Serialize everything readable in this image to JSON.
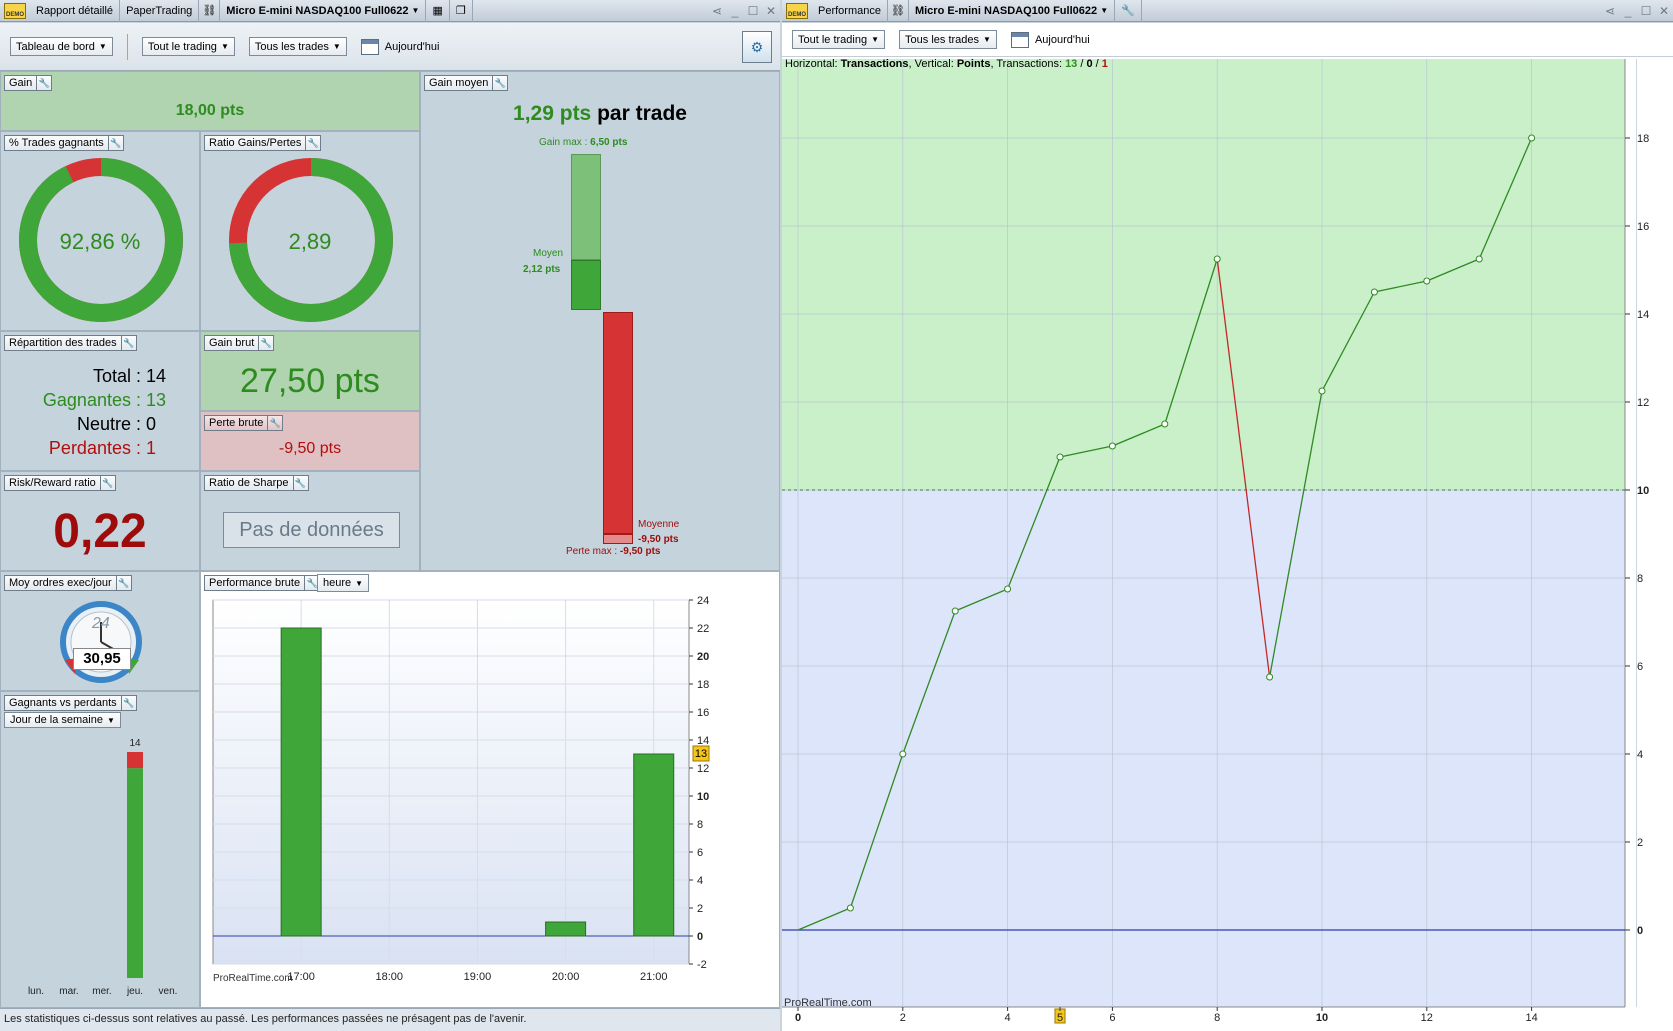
{
  "left_tabs": {
    "report": "Rapport détaillé",
    "paper": "PaperTrading",
    "instrument": "Micro E-mini NASDAQ100 Full0622"
  },
  "demo_label": "DEMO",
  "left_toolbar": {
    "dashboard": "Tableau de bord",
    "trading": "Tout le trading",
    "trades": "Tous les trades",
    "date": "Aujourd'hui"
  },
  "gain": {
    "title": "Gain",
    "value": "18,00 pts"
  },
  "win_pct": {
    "title": "% Trades gagnants",
    "value": "92,86 %",
    "fraction": 0.9286
  },
  "ratio": {
    "title": "Ratio Gains/Pertes",
    "value": "2,89",
    "win_fraction": 0.743
  },
  "avg_gain": {
    "title": "Gain moyen",
    "value": "1,29 pts",
    "suffix": "par trade",
    "max_label": "Gain max :",
    "max_value": "6,50 pts",
    "avg_label": "Moyen",
    "avg_value": "2,12 pts",
    "loss_avg_label": "Moyenne",
    "loss_avg_value": "-9,50 pts",
    "loss_max_label": "Perte max :",
    "loss_max_value": "-9,50 pts"
  },
  "repartition": {
    "title": "Répartition des trades",
    "total": "Total : 14",
    "winners": "Gagnantes : 13",
    "neutral": "Neutre : 0",
    "losers": "Perdantes : 1"
  },
  "gross_gain": {
    "title": "Gain brut",
    "value": "27,50 pts"
  },
  "gross_loss": {
    "title": "Perte brute",
    "value": "-9,50 pts"
  },
  "risk_reward": {
    "title": "Risk/Reward ratio",
    "value": "0,22"
  },
  "sharpe": {
    "title": "Ratio de Sharpe",
    "value": "Pas de données"
  },
  "orders_day": {
    "title": "Moy ordres exec/jour",
    "value": "30,95",
    "dial": "24"
  },
  "gross_perf": {
    "title": "Performance brute",
    "unit": "heure",
    "watermark": "ProRealTime.com",
    "last_marker": "13"
  },
  "win_loss": {
    "title": "Gagnants vs perdants",
    "period": "Jour de la semaine",
    "total_label": "14",
    "days": [
      "lun.",
      "mar.",
      "mer.",
      "jeu.",
      "ven."
    ]
  },
  "footer": "Les statistiques ci-dessus sont relatives au passé. Les performances passées ne présagent pas de l'avenir.",
  "right_tabs": {
    "perf": "Performance",
    "instrument": "Micro E-mini NASDAQ100 Full0622"
  },
  "right_toolbar": {
    "trading": "Tout le trading",
    "trades": "Tous les trades",
    "date": "Aujourd'hui"
  },
  "perf_header": {
    "h_label": "Horizontal:",
    "h_value": "Transactions",
    "v_label": "Vertical:",
    "v_value": "Points",
    "t_label": "Transactions:",
    "t_win": "13",
    "t_neutral": "0",
    "t_loss": "1"
  },
  "perf_watermark": "ProRealTime.com",
  "colors": {
    "green": "#3fa63a",
    "red": "#d63434",
    "darkred": "#9e0b0b",
    "darkgreen": "#2e8b1f"
  },
  "chart_data": [
    {
      "type": "bar",
      "title": "Performance brute",
      "categories": [
        "17:00",
        "18:00",
        "19:00",
        "20:00",
        "21:00"
      ],
      "bars": [
        {
          "x": "17:00",
          "value": 22
        },
        {
          "x": "20:00",
          "value": 1
        },
        {
          "x": "21:00",
          "value": 13
        }
      ],
      "ylim": [
        -2,
        24
      ],
      "yticks": [
        -2,
        0,
        2,
        4,
        6,
        8,
        10,
        12,
        14,
        16,
        18,
        20,
        22,
        24
      ]
    },
    {
      "type": "bar",
      "title": "Gagnants vs perdants",
      "categories": [
        "lun.",
        "mar.",
        "mer.",
        "jeu.",
        "ven."
      ],
      "series": [
        {
          "name": "Gagnants",
          "values": [
            0,
            0,
            0,
            13,
            0
          ]
        },
        {
          "name": "Perdants",
          "values": [
            0,
            0,
            0,
            1,
            0
          ]
        }
      ]
    },
    {
      "type": "line",
      "title": "Performance",
      "xlabel": "Transactions",
      "ylabel": "Points",
      "x": [
        0,
        1,
        2,
        3,
        4,
        5,
        6,
        7,
        8,
        9,
        10,
        11,
        12,
        13,
        14
      ],
      "y": [
        0,
        0.5,
        4,
        7.25,
        7.75,
        10.75,
        11,
        11.5,
        15.25,
        5.75,
        12.25,
        14.5,
        14.75,
        15.25,
        18
      ],
      "xticks": [
        0,
        2,
        4,
        5,
        6,
        8,
        10,
        12,
        14
      ],
      "yticks": [
        0,
        2,
        4,
        6,
        8,
        10,
        12,
        14,
        16,
        18
      ],
      "threshold": 10,
      "ylim": [
        -2,
        20
      ]
    }
  ]
}
